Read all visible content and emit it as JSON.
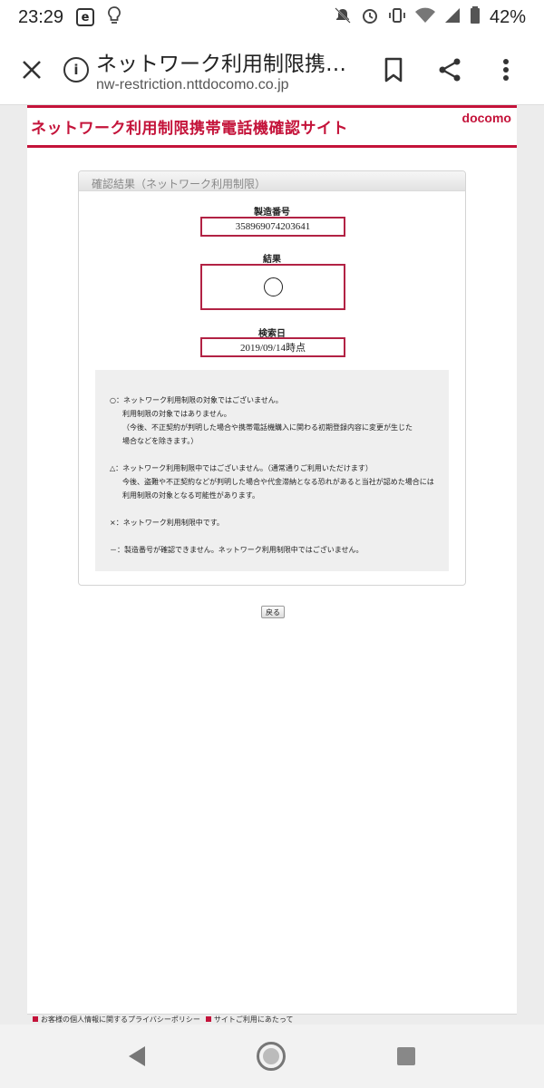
{
  "status_bar": {
    "time": "23:29",
    "app_icon_letter": "e",
    "battery": "42%"
  },
  "toolbar": {
    "title": "ネットワーク利用制限携…",
    "url": "nw-restriction.nttdocomo.co.jp"
  },
  "site": {
    "title": "ネットワーク利用制限携帯電話機確認サイト",
    "logo": "docomo",
    "accent_color": "#c4133a"
  },
  "result_panel": {
    "heading": "確認結果（ネットワーク利用制限）",
    "serial_label": "製造番号",
    "serial_value": "358969074203641",
    "result_label": "結果",
    "result_mark": "circle",
    "date_label": "検索日",
    "date_value": "2019/09/14時点"
  },
  "legend": {
    "circle_line1": "○：ネットワーク利用制限の対象ではございません。",
    "circle_line2": "利用制限の対象ではありません。",
    "circle_line3": "（今後、不正契約が判明した場合や携帯電話機購入に関わる初期登録内容に変更が生じた",
    "circle_line4": "場合などを除きます。）",
    "triangle_line1": "△：ネットワーク利用制限中ではございません。（通常通りご利用いただけます）",
    "triangle_line2": "今後、盗難や不正契約などが判明した場合や代金滞納となる恐れがあると当社が認めた場合には",
    "triangle_line3": "利用制限の対象となる可能性があります。",
    "cross_line": "×：ネットワーク利用制限中です。",
    "dash_line": "－：製造番号が確認できません。ネットワーク利用制限中ではございません。"
  },
  "back_button": "戻る",
  "footer": {
    "privacy_link": "お客様の個人情報に関するプライバシーポリシー",
    "terms_link": "サイトご利用にあたって"
  }
}
